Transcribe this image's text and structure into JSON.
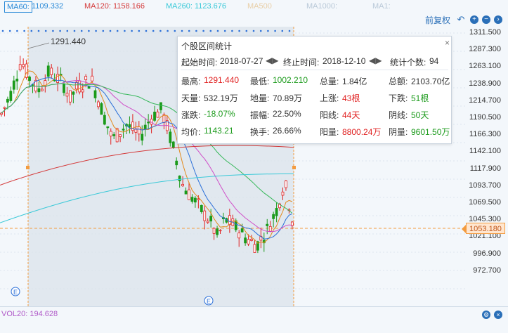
{
  "ma_labels": {
    "ma60": "MA60:",
    "ma60_value": "1109.332",
    "ma120": "MA120: 1158.166",
    "ma260": "MA260: 1123.676",
    "ma500": "MA500",
    "ma1000": "MA1000:",
    "ma1": "MA1:"
  },
  "toolbar": {
    "restore_label": "前复权"
  },
  "high_marker": "1291.440",
  "y_axis": [
    "1311.500",
    "1287.300",
    "1263.100",
    "1238.900",
    "1214.700",
    "1190.500",
    "1166.300",
    "1142.100",
    "1117.900",
    "1093.700",
    "1069.500",
    "1045.300",
    "1021.100",
    "996.900",
    "972.700"
  ],
  "current_price": "1053.180",
  "popup": {
    "title": "个股区间统计",
    "start_label": "起始时间:",
    "start_value": "2018-07-27",
    "end_label": "终止时间:",
    "end_value": "2018-12-10",
    "count_label": "统计个数:",
    "count_value": "94",
    "rows": [
      [
        [
          "最高:",
          "1291.440",
          "red"
        ],
        [
          "最低:",
          "1002.210",
          "green"
        ],
        [
          "总量:",
          "1.84亿",
          ""
        ],
        [
          "总额:",
          "2103.70亿",
          ""
        ]
      ],
      [
        [
          "天量:",
          "532.19万",
          ""
        ],
        [
          "地量:",
          "70.89万",
          ""
        ],
        [
          "上涨:",
          "43根",
          "red"
        ],
        [
          "下跌:",
          "51根",
          "green"
        ]
      ],
      [
        [
          "涨跌:",
          "-18.07%",
          "green"
        ],
        [
          "振幅:",
          "22.50%",
          ""
        ],
        [
          "阳线:",
          "44天",
          "red"
        ],
        [
          "阴线:",
          "50天",
          "green"
        ]
      ],
      [
        [
          "均价:",
          "1143.21",
          "green"
        ],
        [
          "换手:",
          "26.66%",
          ""
        ],
        [
          "阳量:",
          "8800.24万",
          "red"
        ],
        [
          "阴量:",
          "9601.50万",
          "green"
        ]
      ]
    ]
  },
  "volume": {
    "label": "VOL20: 194.628"
  },
  "colors": {
    "up": "#e02020",
    "down": "#1a9a1a",
    "ma_blue": "#2a6fd8",
    "ma_orange": "#e38a1c",
    "ma_pink": "#d04fc8",
    "ma_red": "#d43a3a",
    "ma_cyan": "#39c9d8",
    "ma_green": "#36b85a",
    "selection": "#f39b3f"
  }
}
